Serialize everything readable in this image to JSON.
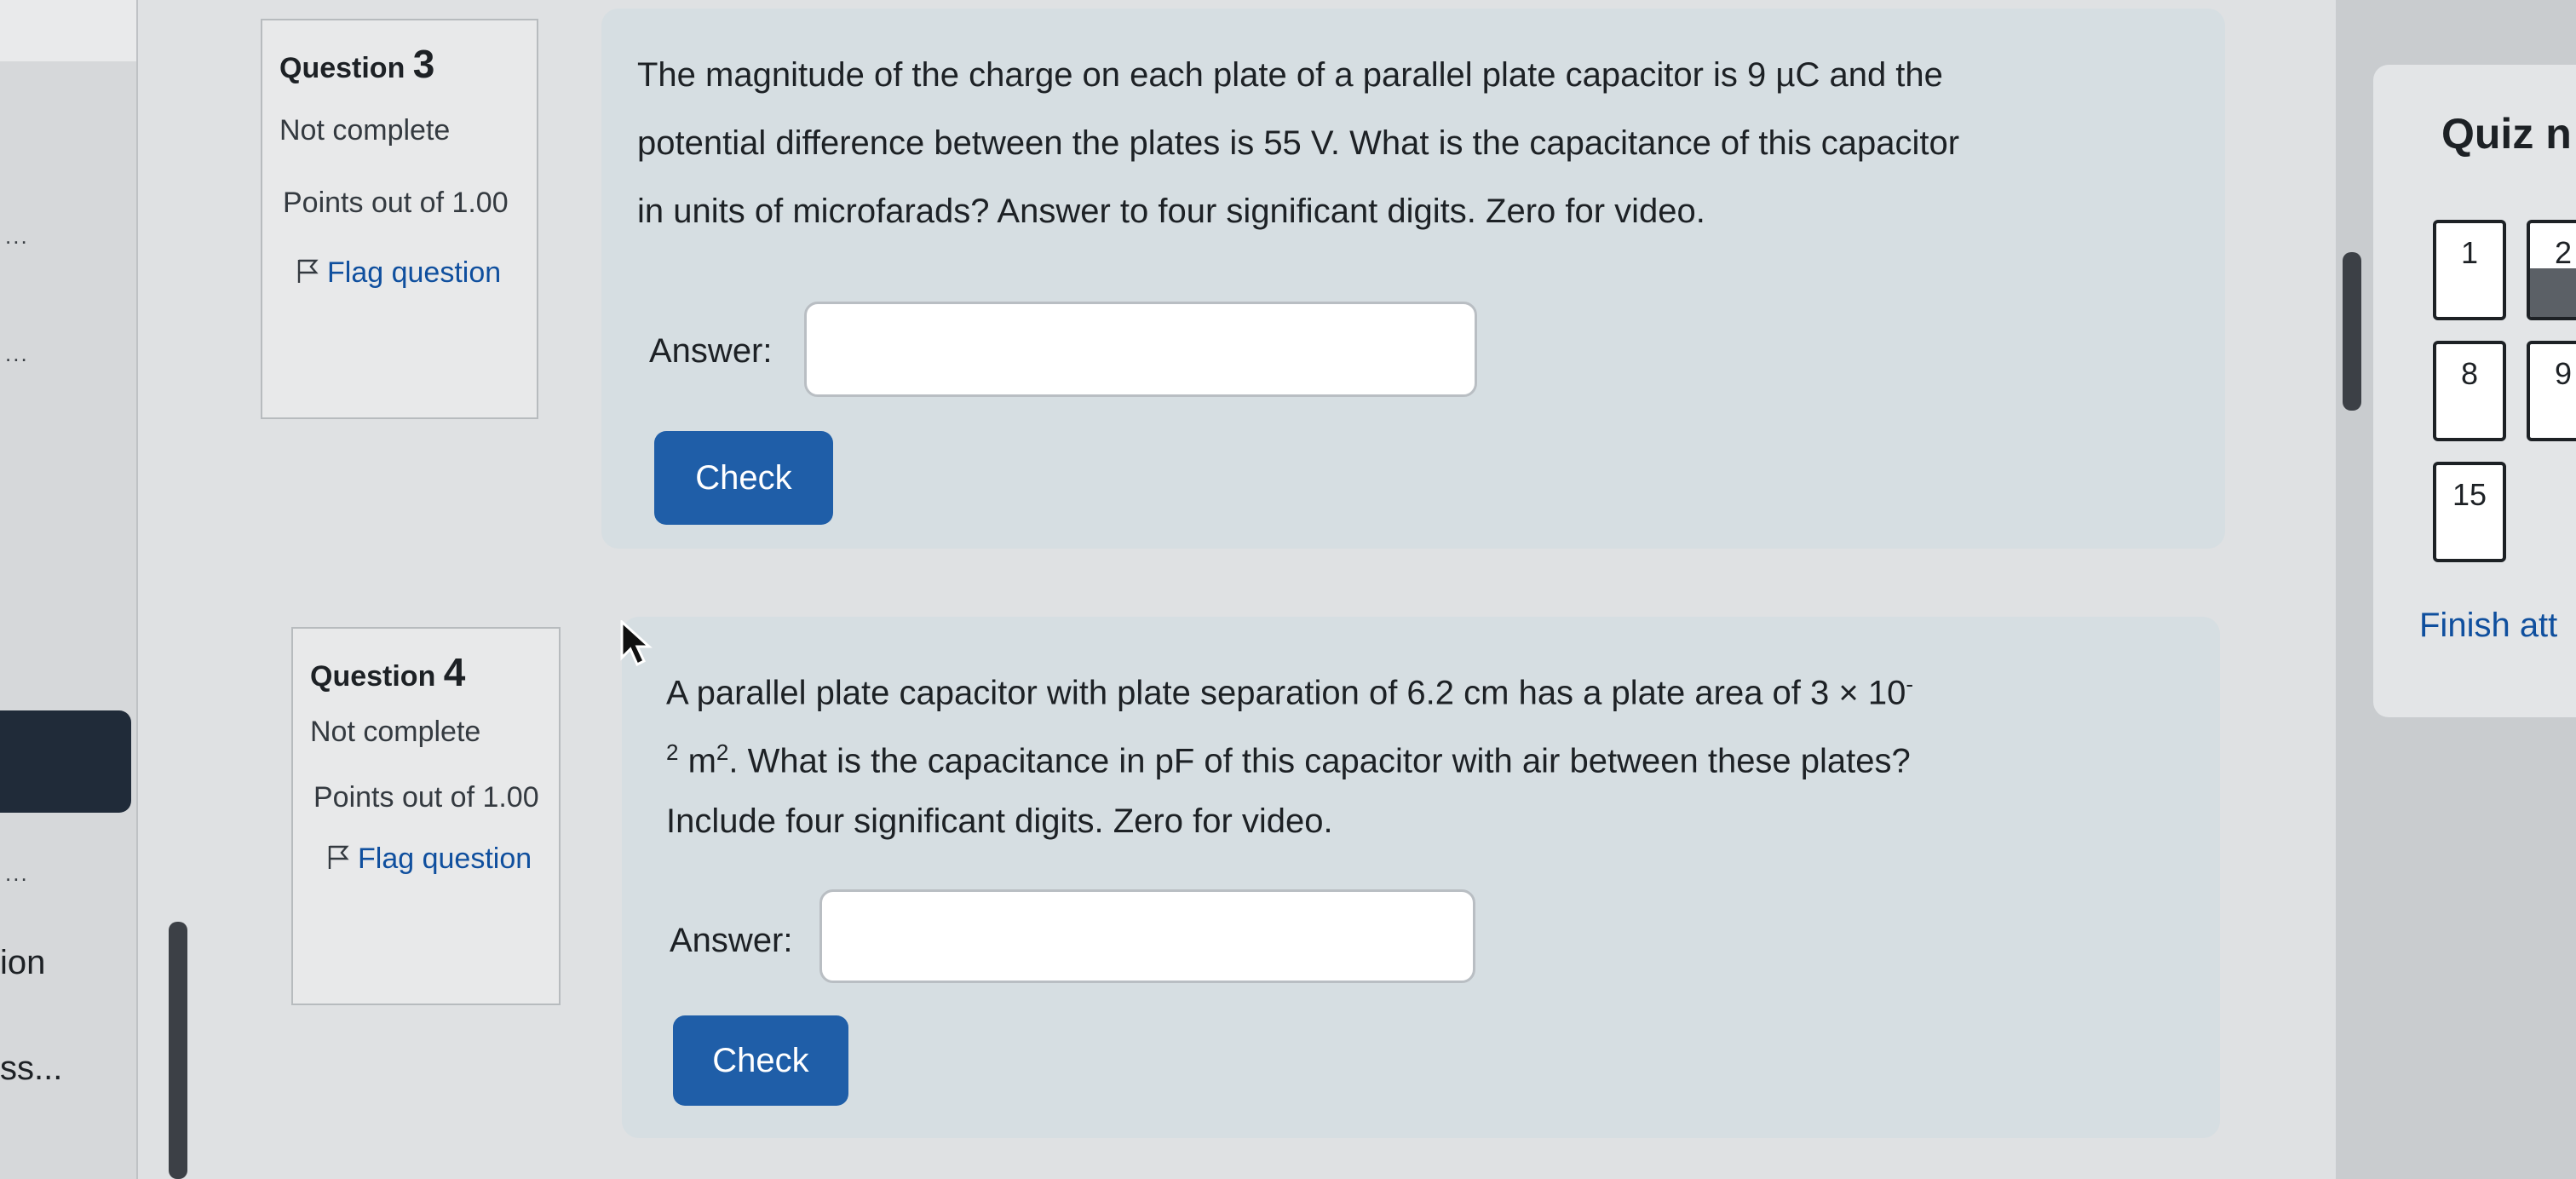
{
  "left_drawer": {
    "ellipsis": "...",
    "partial_item_1": "ion",
    "partial_item_2": "ss..."
  },
  "questions": [
    {
      "number_prefix": "Question",
      "number": "3",
      "state": "Not complete",
      "grade": "Points out of 1.00",
      "flag_label": "Flag question",
      "text_lines": [
        "The magnitude of the charge on each plate of a parallel plate capacitor is 9 µC and the",
        "potential difference between the plates is 55 V. What is the capacitance of this capacitor",
        "in units of microfarads?  Answer to four significant digits.  Zero for video."
      ],
      "answer_label": "Answer:",
      "answer_value": "",
      "check_label": "Check"
    },
    {
      "number_prefix": "Question",
      "number": "4",
      "state": "Not complete",
      "grade": "Points out of 1.00",
      "flag_label": "Flag question",
      "text_line1_main": "A parallel plate capacitor with plate separation of 6.2 cm has a plate area of 3 × 10",
      "text_line1_sup": "-",
      "text_line2_sup_pre": "2",
      "text_line2_unit": " m",
      "text_line2_sup": "2",
      "text_line2_rest": ". What is the capacitance in pF of this capacitor with air between these plates?",
      "text_line3": "Include four significant digits. Zero for video.",
      "answer_label": "Answer:",
      "answer_value": "",
      "check_label": "Check"
    }
  ],
  "quiz_nav": {
    "title": "Quiz n",
    "buttons": [
      {
        "label": "1",
        "answered": false
      },
      {
        "label": "2",
        "answered": true
      },
      {
        "label": "8",
        "answered": false
      },
      {
        "label": "9",
        "answered": false
      },
      {
        "label": "15",
        "answered": false
      }
    ],
    "finish_label": "Finish att"
  },
  "icons": {
    "flag": "flag-icon",
    "cursor": "mouse-pointer-icon"
  }
}
